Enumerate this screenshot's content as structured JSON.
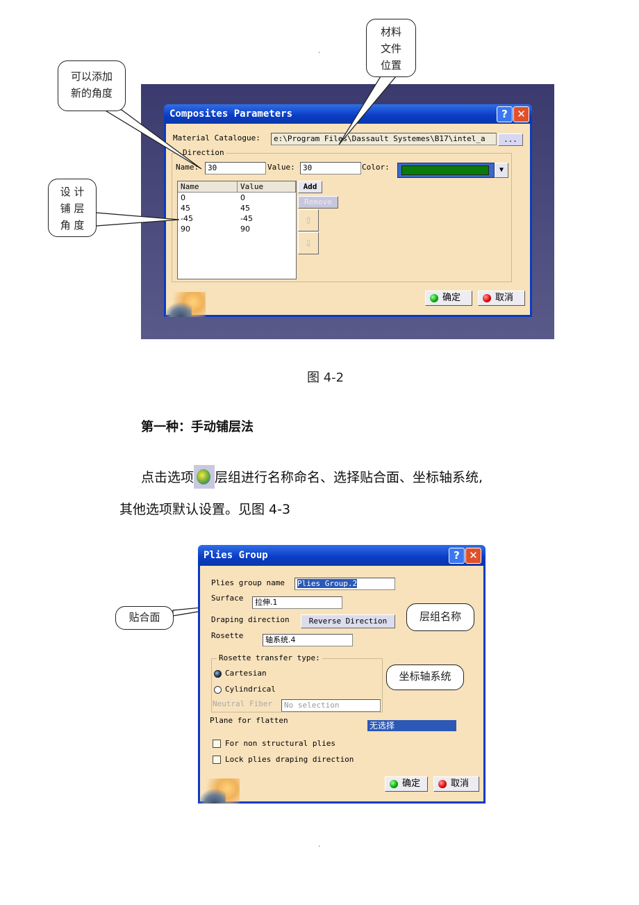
{
  "page": {
    "top_dot": ".",
    "bottom_dot": ".",
    "figure1_caption": "图 4-2",
    "section_heading": "第一种：手动铺层法",
    "paragraph_line1_before_icon": "点击选项",
    "paragraph_line1_after_icon": "层组进行名称命名、选择贴合面、坐标轴系统,",
    "paragraph_line2": "其他选项默认设置。见图 4-3",
    "inline_icon": "plies-group-icon"
  },
  "figure1": {
    "callouts": {
      "add_angle": "可以添加\n新的角度",
      "material_location": "材料\n文件\n位置",
      "design_angles": "设  计\n铺  层\n角  度"
    },
    "dialog": {
      "title": "Composites Parameters",
      "material_catalogue_label": "Material Catalogue:",
      "material_catalogue_value": "e:\\Program Files\\Dassault Systemes\\B17\\intel_a",
      "browse_label": "...",
      "direction_group_label": "Direction",
      "name_label": "Name:",
      "name_value": "30",
      "value_label": "Value:",
      "value_value": "30",
      "color_label": "Color:",
      "color_value": "#0a7a0a",
      "table": {
        "columns": [
          "Name",
          "Value"
        ],
        "rows": [
          {
            "name": "0",
            "value": "0"
          },
          {
            "name": "45",
            "value": "45"
          },
          {
            "name": "-45",
            "value": "-45"
          },
          {
            "name": "90",
            "value": "90"
          }
        ]
      },
      "add_label": "Add",
      "remove_label": "Remove",
      "ok_label": "确定",
      "cancel_label": "取消"
    }
  },
  "figure2": {
    "callouts": {
      "surface": "贴合面",
      "group_name": "层组名称",
      "axis_system": "坐标轴系统"
    },
    "dialog": {
      "title": "Plies Group",
      "plies_group_name_label": "Plies group name",
      "plies_group_name_value": "Plies Group.2",
      "surface_label": "Surface",
      "surface_value": "拉伸.1",
      "draping_direction_label": "Draping direction",
      "reverse_direction_label": "Reverse Direction",
      "rosette_label": "Rosette",
      "rosette_value": "轴系统.4",
      "rosette_transfer_label": "Rosette transfer type:",
      "cartesian_label": "Cartesian",
      "cartesian_selected": true,
      "cylindrical_label": "Cylindrical",
      "cylindrical_selected": false,
      "neutral_fiber_label": "Neutral Fiber",
      "neutral_fiber_value": "No selection",
      "plane_for_flatten_label": "Plane for flatten",
      "plane_for_flatten_value": "无选择",
      "non_structural_label": "For non structural plies",
      "non_structural_checked": false,
      "lock_draping_label": "Lock plies draping direction",
      "lock_draping_checked": false,
      "ok_label": "确定",
      "cancel_label": "取消"
    }
  }
}
